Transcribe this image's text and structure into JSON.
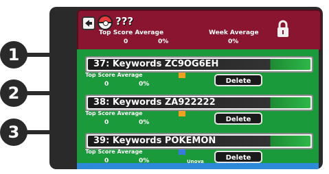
{
  "header": {
    "title": "???",
    "top_score_average_label": "Top Score Average",
    "week_average_label": "Week Average",
    "top_score_average_value": "0",
    "top_score_percent": "0%",
    "week_average_value": "0%"
  },
  "items": [
    {
      "name": "37: Keywords ZC9OG6EH",
      "sub_label": "Top Score Average",
      "score": "0",
      "percent": "0%",
      "delete_label": "Delete"
    },
    {
      "name": "38: Keywords ZA922222",
      "sub_label": "Top Score Average",
      "score": "0",
      "percent": "0%",
      "delete_label": "Delete"
    },
    {
      "name": "39: Keywords POKEMON",
      "sub_label": "Top Score Average",
      "score": "0",
      "percent": "0%",
      "delete_label": "Delete",
      "region": "Unova"
    }
  ],
  "callouts": [
    "1",
    "2",
    "3"
  ],
  "colors": {
    "header_red": "#8a1530",
    "list_green": "#1a9a3a",
    "footer_blue": "#2e8ad8"
  }
}
